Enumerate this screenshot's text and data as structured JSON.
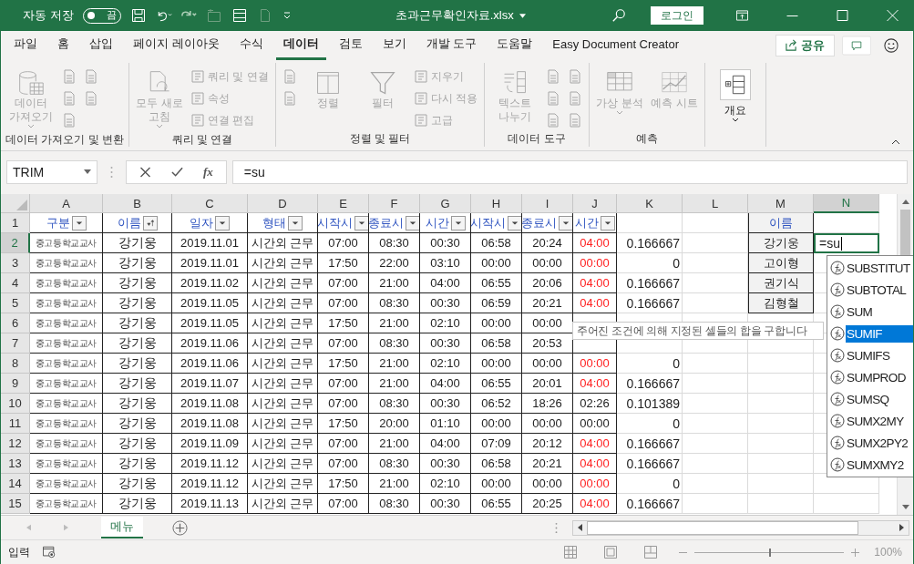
{
  "title_bar": {
    "autosave": {
      "label": "자동 저장",
      "on": false,
      "state_label": "끔"
    },
    "title": "초과근무확인자료.xlsx",
    "login": "로그인"
  },
  "menu_tabs": [
    {
      "label": "파일",
      "selected": false
    },
    {
      "label": "홈",
      "selected": false
    },
    {
      "label": "삽입",
      "selected": false
    },
    {
      "label": "페이지 레이아웃",
      "selected": false
    },
    {
      "label": "수식",
      "selected": false
    },
    {
      "label": "데이터",
      "selected": true
    },
    {
      "label": "검토",
      "selected": false
    },
    {
      "label": "보기",
      "selected": false
    },
    {
      "label": "개발 도구",
      "selected": false
    },
    {
      "label": "도움말",
      "selected": false
    },
    {
      "label": "Easy Document Creator",
      "selected": false
    }
  ],
  "share_button": "공유",
  "ribbon": {
    "groups": [
      {
        "label": "데이터 가져오기 및 변환",
        "buttons": [
          {
            "kind": "large",
            "label": "데이터 가져오기",
            "disabled": true,
            "dropdown": true
          },
          {
            "kind": "icon",
            "disabled": true
          },
          {
            "kind": "icon",
            "disabled": true
          },
          {
            "kind": "icon",
            "disabled": true
          },
          {
            "kind": "icon",
            "disabled": true
          },
          {
            "kind": "icon",
            "disabled": true
          }
        ]
      },
      {
        "label": "쿼리 및 연결",
        "buttons": [
          {
            "kind": "large",
            "label": "모두 새로 고침",
            "disabled": true,
            "dropdown": true
          },
          {
            "kind": "small",
            "label": "쿼리 및 연결",
            "disabled": true
          },
          {
            "kind": "small",
            "label": "속성",
            "disabled": true
          },
          {
            "kind": "small",
            "label": "연결 편집",
            "disabled": true
          }
        ]
      },
      {
        "label": "정렬 및 필터",
        "buttons": [
          {
            "kind": "icon",
            "disabled": true
          },
          {
            "kind": "icon",
            "disabled": true
          },
          {
            "kind": "large",
            "label": "정렬",
            "disabled": true,
            "dropdown": false
          },
          {
            "kind": "large",
            "label": "필터",
            "disabled": true,
            "dropdown": false
          },
          {
            "kind": "small",
            "label": "지우기",
            "disabled": true
          },
          {
            "kind": "small",
            "label": "다시 적용",
            "disabled": true
          },
          {
            "kind": "small",
            "label": "고급",
            "disabled": true
          }
        ]
      },
      {
        "label": "데이터 도구",
        "buttons": [
          {
            "kind": "large",
            "label": "텍스트 나누기",
            "disabled": true,
            "dropdown": false
          },
          {
            "kind": "icon",
            "disabled": true
          },
          {
            "kind": "icon",
            "disabled": true
          },
          {
            "kind": "icon",
            "disabled": true
          },
          {
            "kind": "icon",
            "disabled": true
          },
          {
            "kind": "icon",
            "disabled": true
          },
          {
            "kind": "icon",
            "disabled": true
          }
        ]
      },
      {
        "label": "예측",
        "buttons": [
          {
            "kind": "large",
            "label": "가상 분석",
            "disabled": true,
            "dropdown": true
          },
          {
            "kind": "large",
            "label": "예측 시트",
            "disabled": true,
            "dropdown": false
          }
        ]
      },
      {
        "buttons": [
          {
            "kind": "large",
            "label": "개요",
            "disabled": false,
            "dropdown": true
          }
        ]
      }
    ]
  },
  "formula_bar": {
    "name_box": "TRIM",
    "function_label": "fx",
    "formula": "=su"
  },
  "columns": [
    {
      "letter": "A",
      "selected": false
    },
    {
      "letter": "B",
      "selected": false
    },
    {
      "letter": "C",
      "selected": false
    },
    {
      "letter": "D",
      "selected": false
    },
    {
      "letter": "E",
      "selected": false
    },
    {
      "letter": "F",
      "selected": false
    },
    {
      "letter": "G",
      "selected": false
    },
    {
      "letter": "H",
      "selected": false
    },
    {
      "letter": "I",
      "selected": false
    },
    {
      "letter": "J",
      "selected": false
    },
    {
      "letter": "K",
      "selected": false
    },
    {
      "letter": "L",
      "selected": false
    },
    {
      "letter": "M",
      "selected": false
    },
    {
      "letter": "N",
      "selected": true
    }
  ],
  "header_row": {
    "num": "1",
    "selected": false,
    "filters": [
      {
        "label": "구분",
        "sorted": false
      },
      {
        "label": "이름",
        "sorted": true
      },
      {
        "label": "일자",
        "sorted": false
      },
      {
        "label": "형태",
        "sorted": false
      },
      {
        "label": "시작시",
        "sorted": false
      },
      {
        "label": "종료시",
        "sorted": false
      },
      {
        "label": "시간",
        "sorted": false
      },
      {
        "label": "시작시",
        "sorted": false
      },
      {
        "label": "종료시",
        "sorted": false
      },
      {
        "label": "시간",
        "sorted": false
      }
    ],
    "lookup_header": "이름"
  },
  "rows": [
    {
      "num": "2",
      "selected": true,
      "a": "중고등학교교사",
      "b": "강기웅",
      "c": "2019.11.01",
      "d": "시간외 근무",
      "e": "07:00",
      "f": "08:30",
      "g": "00:30",
      "h": "06:58",
      "i": "20:24",
      "j": "04:00",
      "j_alert": true,
      "k": "0.166667",
      "m": "강기웅"
    },
    {
      "num": "3",
      "selected": false,
      "a": "중고등학교교사",
      "b": "강기웅",
      "c": "2019.11.01",
      "d": "시간외 근무",
      "e": "17:50",
      "f": "22:00",
      "g": "03:10",
      "h": "00:00",
      "i": "00:00",
      "j": "00:00",
      "j_alert": true,
      "k": "0",
      "m": "고이형"
    },
    {
      "num": "4",
      "selected": false,
      "a": "중고등학교교사",
      "b": "강기웅",
      "c": "2019.11.02",
      "d": "시간외 근무",
      "e": "07:00",
      "f": "21:00",
      "g": "04:00",
      "h": "06:55",
      "i": "20:06",
      "j": "04:00",
      "j_alert": true,
      "k": "0.166667",
      "m": "권기식"
    },
    {
      "num": "5",
      "selected": false,
      "a": "중고등학교교사",
      "b": "강기웅",
      "c": "2019.11.05",
      "d": "시간외 근무",
      "e": "07:00",
      "f": "08:30",
      "g": "00:30",
      "h": "06:59",
      "i": "20:21",
      "j": "04:00",
      "j_alert": true,
      "k": "0.166667",
      "m": "김형철"
    },
    {
      "num": "6",
      "selected": false,
      "a": "중고등학교교사",
      "b": "강기웅",
      "c": "2019.11.05",
      "d": "시간외 근무",
      "e": "17:50",
      "f": "21:00",
      "g": "02:10",
      "h": "00:00",
      "i": "00:00"
    },
    {
      "num": "7",
      "selected": false,
      "a": "중고등학교교사",
      "b": "강기웅",
      "c": "2019.11.06",
      "d": "시간외 근무",
      "e": "07:00",
      "f": "08:30",
      "g": "00:30",
      "h": "06:58",
      "i": "20:53"
    },
    {
      "num": "8",
      "selected": false,
      "a": "중고등학교교사",
      "b": "강기웅",
      "c": "2019.11.06",
      "d": "시간외 근무",
      "e": "17:50",
      "f": "21:00",
      "g": "02:10",
      "h": "00:00",
      "i": "00:00",
      "j": "00:00",
      "j_alert": true,
      "k": "0"
    },
    {
      "num": "9",
      "selected": false,
      "a": "중고등학교교사",
      "b": "강기웅",
      "c": "2019.11.07",
      "d": "시간외 근무",
      "e": "07:00",
      "f": "21:00",
      "g": "04:00",
      "h": "06:55",
      "i": "20:01",
      "j": "04:00",
      "j_alert": true,
      "k": "0.166667"
    },
    {
      "num": "10",
      "selected": false,
      "a": "중고등학교교사",
      "b": "강기웅",
      "c": "2019.11.08",
      "d": "시간외 근무",
      "e": "07:00",
      "f": "08:30",
      "g": "00:30",
      "h": "06:52",
      "i": "18:26",
      "j": "02:26",
      "j_alert": false,
      "k": "0.101389"
    },
    {
      "num": "11",
      "selected": false,
      "a": "중고등학교교사",
      "b": "강기웅",
      "c": "2019.11.08",
      "d": "시간외 근무",
      "e": "17:50",
      "f": "20:00",
      "g": "01:10",
      "h": "00:00",
      "i": "00:00",
      "j": "00:00",
      "j_alert": false,
      "k": "0"
    },
    {
      "num": "12",
      "selected": false,
      "a": "중고등학교교사",
      "b": "강기웅",
      "c": "2019.11.09",
      "d": "시간외 근무",
      "e": "07:00",
      "f": "21:00",
      "g": "04:00",
      "h": "07:09",
      "i": "20:12",
      "j": "04:00",
      "j_alert": true,
      "k": "0.166667"
    },
    {
      "num": "13",
      "selected": false,
      "a": "중고등학교교사",
      "b": "강기웅",
      "c": "2019.11.12",
      "d": "시간외 근무",
      "e": "07:00",
      "f": "08:30",
      "g": "00:30",
      "h": "06:58",
      "i": "20:21",
      "j": "04:00",
      "j_alert": true,
      "k": "0.166667"
    },
    {
      "num": "14",
      "selected": false,
      "a": "중고등학교교사",
      "b": "강기웅",
      "c": "2019.11.12",
      "d": "시간외 근무",
      "e": "17:50",
      "f": "21:00",
      "g": "02:10",
      "h": "00:00",
      "i": "00:00",
      "j": "00:00",
      "j_alert": true,
      "k": "0"
    },
    {
      "num": "15",
      "selected": false,
      "a": "중고등학교교사",
      "b": "강기웅",
      "c": "2019.11.13",
      "d": "시간외 근무",
      "e": "07:00",
      "f": "08:30",
      "g": "00:30",
      "h": "06:55",
      "i": "20:25",
      "j": "04:00",
      "j_alert": true,
      "k": "0.166667"
    }
  ],
  "active_cell": {
    "value": "=su"
  },
  "tooltip": "주어진 조건에 의해 지정된 셀들의 합을 구합니다",
  "autocomplete": [
    {
      "label": "SUBSTITUT",
      "selected": false
    },
    {
      "label": "SUBTOTAL",
      "selected": false
    },
    {
      "label": "SUM",
      "selected": false
    },
    {
      "label": "SUMIF",
      "selected": true
    },
    {
      "label": "SUMIFS",
      "selected": false
    },
    {
      "label": "SUMPROD",
      "selected": false
    },
    {
      "label": "SUMSQ",
      "selected": false
    },
    {
      "label": "SUMX2MY",
      "selected": false
    },
    {
      "label": "SUMX2PY2",
      "selected": false
    },
    {
      "label": "SUMXMY2",
      "selected": false
    }
  ],
  "sheet_tabs": [
    {
      "label": "메뉴",
      "selected": true
    }
  ],
  "status_bar": {
    "mode": "입력",
    "zoom": {
      "level": 0.5,
      "label": "100%"
    }
  }
}
